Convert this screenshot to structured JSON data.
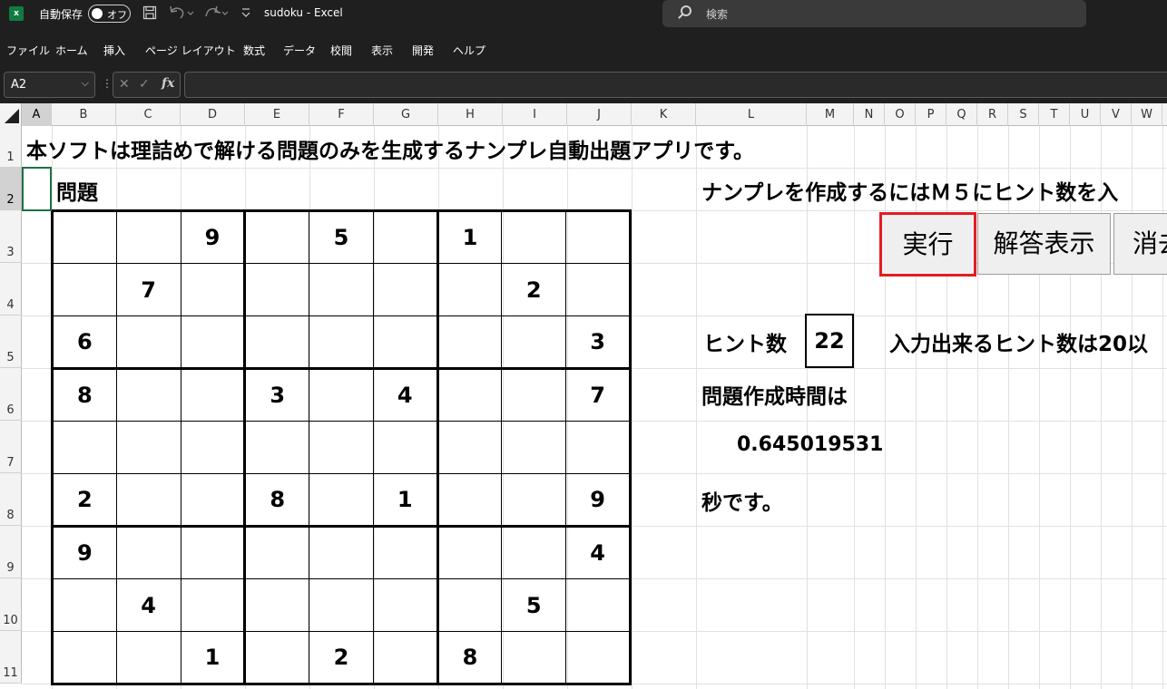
{
  "titlebar": {
    "logo": "x",
    "autosave_label": "自動保存",
    "autosave_state": "オフ",
    "doc_title": "sudoku  -  Excel",
    "search_placeholder": "検索"
  },
  "menu": [
    "ファイル",
    "ホーム",
    "挿入",
    "ページ レイアウト",
    "数式",
    "データ",
    "校閲",
    "表示",
    "開発",
    "ヘルプ"
  ],
  "formula_bar": {
    "name_box": "A2",
    "chevron": "⌵",
    "dots": "⋮",
    "cancel": "✕",
    "enter": "✓",
    "fx": "fx",
    "value": ""
  },
  "columns": [
    "A",
    "B",
    "C",
    "D",
    "E",
    "F",
    "G",
    "H",
    "I",
    "J",
    "K",
    "L",
    "M",
    "N",
    "O",
    "P",
    "Q",
    "R",
    "S",
    "T",
    "U",
    "V",
    "W"
  ],
  "rows": [
    "1",
    "2",
    "3",
    "4",
    "5",
    "6",
    "7",
    "8",
    "9",
    "10",
    "11"
  ],
  "sheet": {
    "intro": "本ソフトは理詰めで解ける問題のみを生成するナンプレ自動出題アプリです。",
    "problem_label": "問題",
    "instruction": "ナンプレを作成するにはＭ５にヒント数を入",
    "hint_label": "ヒント数",
    "hint_count": "22",
    "hint_range_note": "入力出来るヒント数は20以",
    "time_label": "問題作成時間は",
    "time_value": "0.645019531",
    "time_unit": "秒です。"
  },
  "buttons": {
    "run": "実行",
    "show_answer": "解答表示",
    "clear": "消去"
  },
  "sudoku": [
    [
      "",
      "",
      "9",
      "",
      "5",
      "",
      "1",
      "",
      ""
    ],
    [
      "",
      "7",
      "",
      "",
      "",
      "",
      "",
      "2",
      ""
    ],
    [
      "6",
      "",
      "",
      "",
      "",
      "",
      "",
      "",
      "3"
    ],
    [
      "8",
      "",
      "",
      "3",
      "",
      "4",
      "",
      "",
      "7"
    ],
    [
      "",
      "",
      "",
      "",
      "",
      "",
      "",
      "",
      ""
    ],
    [
      "2",
      "",
      "",
      "8",
      "",
      "1",
      "",
      "",
      "9"
    ],
    [
      "9",
      "",
      "",
      "",
      "",
      "",
      "",
      "",
      "4"
    ],
    [
      "",
      "4",
      "",
      "",
      "",
      "",
      "",
      "5",
      ""
    ],
    [
      "",
      "",
      "1",
      "",
      "2",
      "",
      "8",
      "",
      ""
    ]
  ]
}
